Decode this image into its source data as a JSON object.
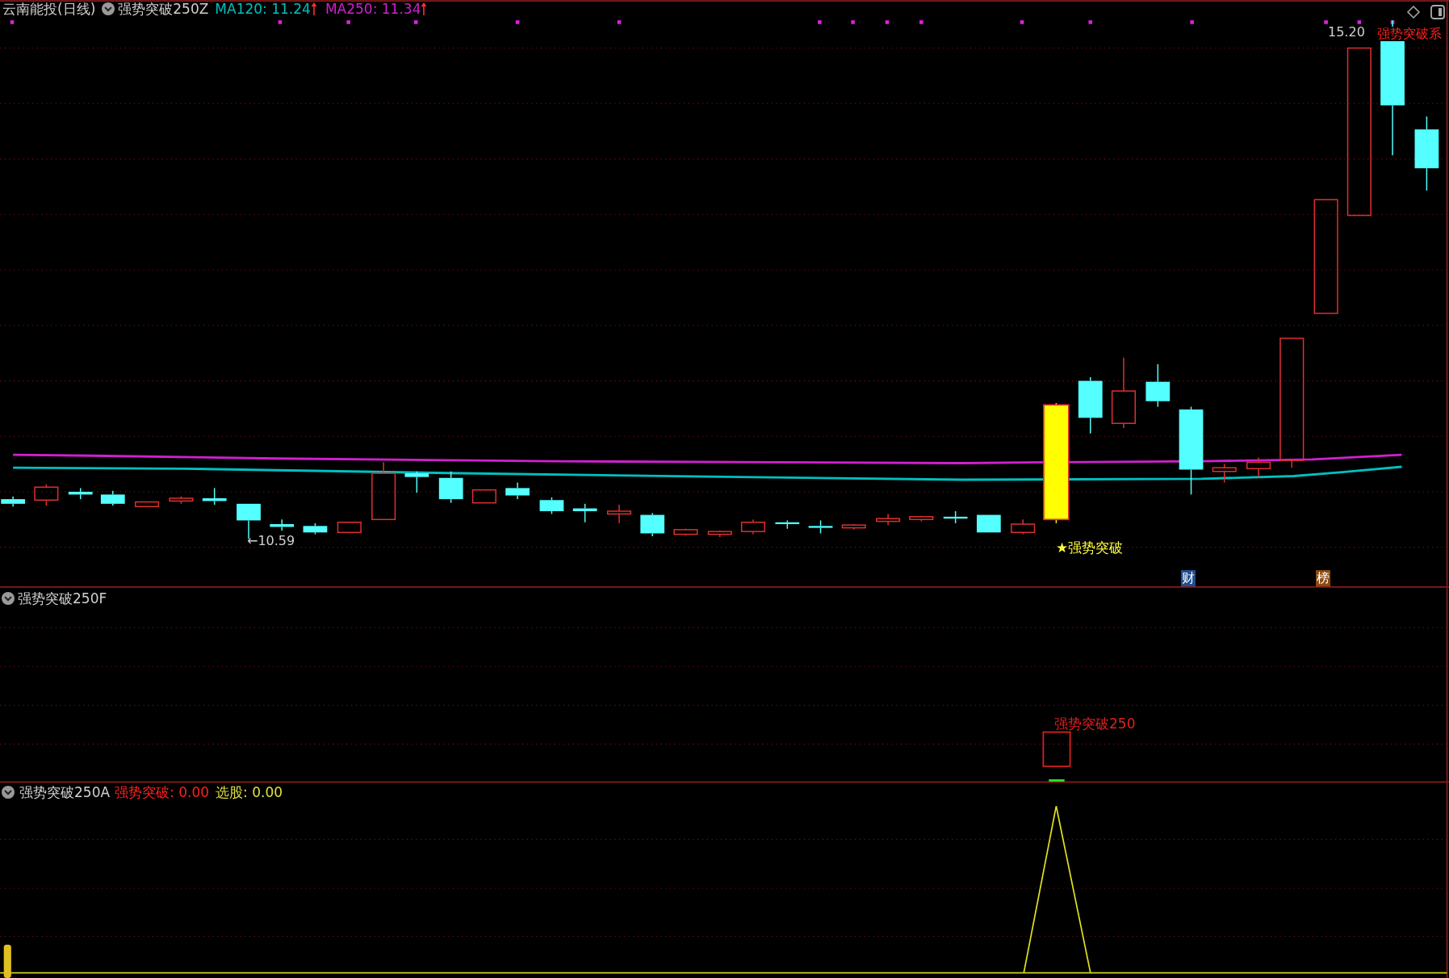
{
  "header": {
    "stock": "云南能投(日线)",
    "indicator": "强势突破250Z",
    "ma_lines": [
      {
        "label": "MA120: 11.24",
        "color": "#00c0c0"
      },
      {
        "label": "MA250: 11.34",
        "color": "#d020d0"
      }
    ]
  },
  "main_chart": {
    "low_label": "←10.59",
    "high_label": "15.20",
    "corner_label": "强势突破系",
    "signal_label": "★强势突破",
    "badges": [
      {
        "text": "财",
        "color": "#1f4f8f"
      },
      {
        "text": "榜",
        "color": "#8a4a10"
      }
    ]
  },
  "panel_2": {
    "title": "强势突破250F",
    "signal_label": "强势突破250"
  },
  "panel_3": {
    "title": "强势突破250A",
    "values": [
      {
        "label": "强势突破: 0.00",
        "color": "#ff2020"
      },
      {
        "label": "选股: 0.00",
        "color": "#e0e040"
      }
    ]
  }
}
